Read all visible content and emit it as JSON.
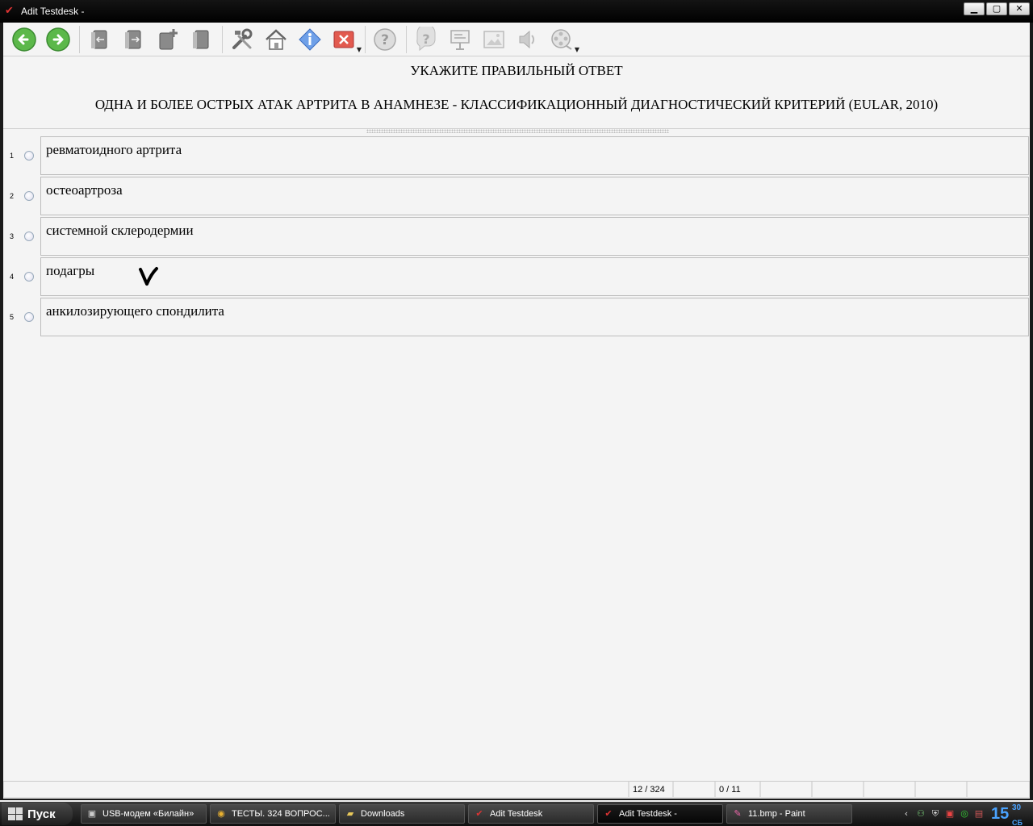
{
  "window": {
    "title": "Adit Testdesk -",
    "min_label": "▁",
    "max_label": "▢",
    "close_label": "✕"
  },
  "toolbar": {
    "items": [
      {
        "name": "back-icon"
      },
      {
        "name": "forward-icon"
      },
      {
        "name": "book-prev-icon"
      },
      {
        "name": "book-next-icon"
      },
      {
        "name": "book-add-icon"
      },
      {
        "name": "book-icon"
      },
      {
        "name": "tools-icon"
      },
      {
        "name": "home-icon"
      },
      {
        "name": "info-icon"
      },
      {
        "name": "close-icon"
      },
      {
        "name": "help-icon"
      },
      {
        "name": "hint-icon"
      },
      {
        "name": "presentation-icon"
      },
      {
        "name": "image-icon"
      },
      {
        "name": "sound-icon"
      },
      {
        "name": "video-icon"
      }
    ]
  },
  "question": {
    "instruction": "УКАЖИТЕ ПРАВИЛЬНЫЙ ОТВЕТ",
    "text": "ОДНА И БОЛЕЕ ОСТРЫХ АТАК АРТРИТА В АНАМНЕЗЕ - КЛАССИФИКАЦИОННЫЙ ДИАГНОСТИЧЕСКИЙ КРИТЕРИЙ (EULAR, 2010)"
  },
  "answers": [
    {
      "num": "1",
      "text": "ревматоидного артрита"
    },
    {
      "num": "2",
      "text": "остеоартроза"
    },
    {
      "num": "3",
      "text": "системной склеродермии"
    },
    {
      "num": "4",
      "text": "подагры"
    },
    {
      "num": "5",
      "text": "анкилозирующего спондилита"
    }
  ],
  "statusbar": {
    "progress": "12 / 324",
    "score": "0 / 11"
  },
  "taskbar": {
    "start_label": "Пуск",
    "tasks": [
      {
        "label": "USB-модем «Билайн»",
        "icon": "modem-icon"
      },
      {
        "label": "ТЕСТЫ. 324 ВОПРОС...",
        "icon": "chrome-icon"
      },
      {
        "label": "Downloads",
        "icon": "folder-icon"
      },
      {
        "label": "Adit Testdesk",
        "icon": "testdesk-icon"
      },
      {
        "label": "Adit Testdesk -",
        "icon": "testdesk-icon"
      },
      {
        "label": "11.bmp - Paint",
        "icon": "paint-icon"
      }
    ],
    "clock_hour": "15",
    "clock_min": "30",
    "clock_day": "СБ"
  },
  "colors": {
    "accent_green": "#5cb84a",
    "close_red": "#d9443a",
    "info_blue": "#4a7fd4",
    "clock_blue": "#4aa3ff"
  }
}
